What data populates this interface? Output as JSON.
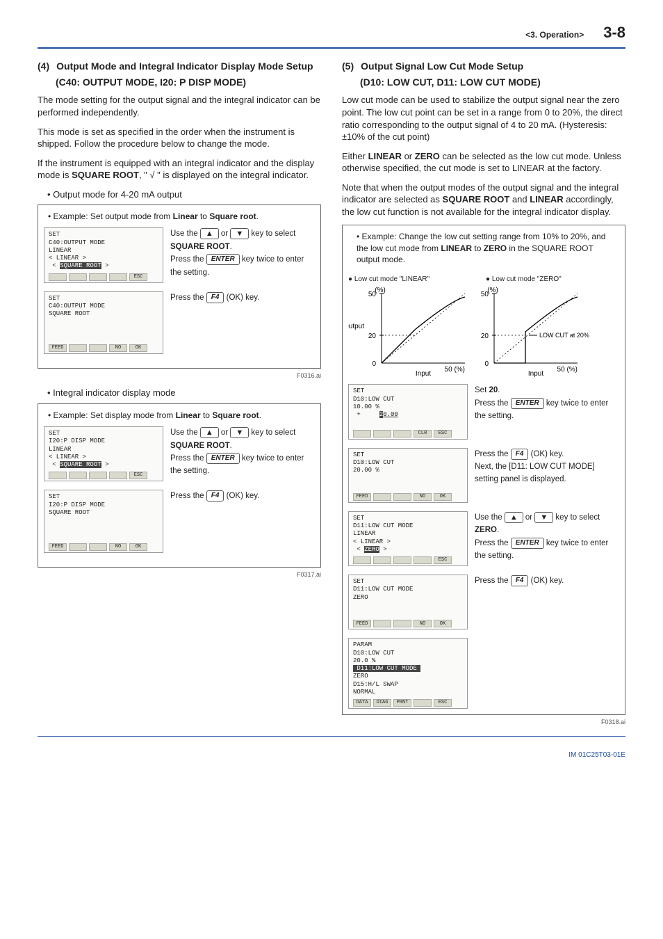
{
  "header": {
    "chapter": "<3. Operation>",
    "page": "3-8"
  },
  "left": {
    "sec_num": "(4)",
    "sec_title": "Output Mode and Integral Indicator Display Mode Setup",
    "sec_sub": "(C40: OUTPUT MODE, I20: P DISP MODE)",
    "p1": "The mode setting for the output signal and the integral indicator can be performed independently.",
    "p2": "This mode is set as specified in the order when the instrument is shipped. Follow the procedure below to change the mode.",
    "p3_pre": "If the instrument is equipped with an integral indicator and the display mode is ",
    "p3_bold": "SQUARE ROOT",
    "p3_post": ", \" √  \" is displayed on the integral indicator.",
    "bullet_a": "• Output mode for 4-20 mA output",
    "fig1": {
      "ex_pre": "• Example: Set output mode from ",
      "ex_b1": "Linear",
      "ex_mid": " to ",
      "ex_b2": "Square root",
      "ex_post": ".",
      "lcd1": [
        "SET",
        " C40:OUTPUT MODE",
        "   LINEAR",
        " < LINEAR        >",
        " < SQUARE ROOT   >"
      ],
      "lcd1_btns": [
        "",
        "",
        "",
        "",
        "ESC"
      ],
      "t1a": "Use the ",
      "t1b": " or ",
      "t1c": " key to select ",
      "t1bold": "SQUARE ROOT",
      "t1d": ".",
      "t1e": "Press the ",
      "t1f": " key twice to enter the setting.",
      "lcd2": [
        "SET",
        " C40:OUTPUT MODE",
        "   SQUARE ROOT",
        "",
        ""
      ],
      "lcd2_btns": [
        "FEED",
        "",
        "",
        "NO",
        "OK"
      ],
      "t2a": "Press the ",
      "t2b": " (OK) key.",
      "code": "F0316.ai"
    },
    "bullet_b": "• Integral indicator display mode",
    "fig2": {
      "ex_pre": "• Example: Set display mode from ",
      "ex_b1": "Linear",
      "ex_mid": " to ",
      "ex_b2": "Square root",
      "ex_post": ".",
      "lcd1": [
        "SET",
        " I20:P DISP MODE",
        "   LINEAR",
        " < LINEAR        >",
        " < SQUARE ROOT   >"
      ],
      "lcd1_btns": [
        "",
        "",
        "",
        "",
        "ESC"
      ],
      "lcd2": [
        "SET",
        " I20:P DISP MODE",
        "   SQUARE ROOT",
        "",
        ""
      ],
      "lcd2_btns": [
        "FEED",
        "",
        "",
        "NO",
        "OK"
      ],
      "code": "F0317.ai"
    }
  },
  "right": {
    "sec_num": "(5)",
    "sec_title": "Output Signal Low Cut Mode Setup",
    "sec_sub": "(D10: LOW CUT, D11: LOW CUT MODE)",
    "p1": "Low cut mode can be used to stabilize the output signal near the zero point. The low cut point can be set in a range from 0 to 20%, the direct ratio corresponding to the output signal of 4 to 20 mA. (Hysteresis: ±10% of the cut point)",
    "p2_pre": "Either ",
    "p2_b1": "LINEAR",
    "p2_mid": " or ",
    "p2_b2": "ZERO",
    "p2_mid2": " can be selected as the low cut mode. Unless otherwise specified, the cut mode is set to LINEAR at the factory.",
    "p3_pre": "Note that when the output modes of the output signal and the integral indicator are selected as ",
    "p3_b1": "SQUARE ROOT",
    "p3_mid": " and ",
    "p3_b2": "LINEAR",
    "p3_post": " accordingly, the low cut function is not available for the integral indicator display.",
    "fig": {
      "ex_pre": "• Example: Change the low cut setting range from 10% to 20%, and the low cut mode from ",
      "ex_b1": "LINEAR",
      "ex_mid": " to ",
      "ex_b2": "ZERO",
      "ex_post": " in the SQUARE ROOT output mode.",
      "g1": "● Low cut mode \"LINEAR\"",
      "g2": "● Low cut mode \"ZERO\"",
      "gy": "(%)",
      "g50": "50",
      "g20": "20",
      "g0": "0",
      "gout": "Output",
      "gin": "Input",
      "g50p": "50 (%)",
      "glc": "LOW CUT at 20%",
      "lcd1": [
        "SET",
        " D10:LOW CUT",
        "       10.00 %",
        " +     20.00",
        ""
      ],
      "lcd1_btns": [
        "",
        "",
        "",
        "CLR",
        "ESC"
      ],
      "t1a": "Set ",
      "t1b": "20",
      "t1c": ".",
      "t1d": "Press the ",
      "t1e": " key twice to enter the setting.",
      "lcd2": [
        "SET",
        " D10:LOW CUT",
        "       20.00 %",
        "",
        ""
      ],
      "lcd2_btns": [
        "FEED",
        "",
        "",
        "NO",
        "OK"
      ],
      "t2a": "Press the ",
      "t2b": " (OK) key.",
      "t2c": "Next, the [D11: LOW CUT MODE] setting panel is displayed.",
      "lcd3": [
        "SET",
        " D11:LOW CUT MODE",
        "   LINEAR",
        " < LINEAR >",
        " < ZERO   >"
      ],
      "lcd3_btns": [
        "",
        "",
        "",
        "",
        "ESC"
      ],
      "t3a": "Use the ",
      "t3b": " or ",
      "t3c": " key to select ",
      "t3bold": "ZERO",
      "t3d": ".",
      "t3e": "Press the ",
      "t3f": " key twice to enter the setting.",
      "lcd4": [
        "SET",
        " D11:LOW CUT MODE",
        "   ZERO",
        "",
        ""
      ],
      "lcd4_btns": [
        "FEED",
        "",
        "",
        "NO",
        "OK"
      ],
      "t4a": "Press the ",
      "t4b": " (OK) key.",
      "lcd5": [
        "PARAM",
        " D10:LOW CUT",
        "       20.0 %",
        " D11:LOW CUT MODE",
        "   ZERO",
        " D15:H/L SWAP",
        "   NORMAL"
      ],
      "lcd5_btns": [
        "DATA",
        "DIAG",
        "PRNT",
        "",
        "ESC"
      ],
      "code": "F0318.ai"
    }
  },
  "footer": "IM 01C25T03-01E"
}
